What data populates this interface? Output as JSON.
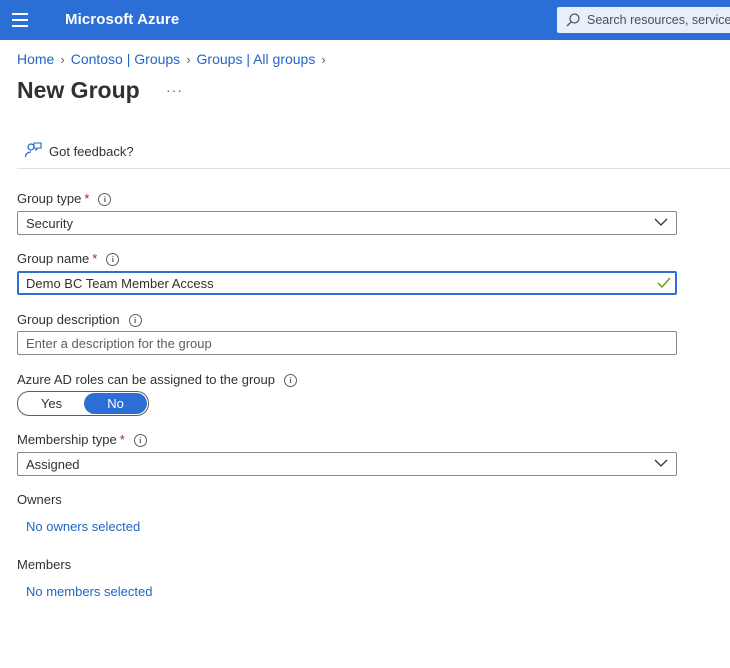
{
  "header": {
    "brand": "Microsoft Azure",
    "search_placeholder": "Search resources, services, and docs"
  },
  "breadcrumb": {
    "items": [
      "Home",
      "Contoso | Groups",
      "Groups | All groups"
    ]
  },
  "page": {
    "title": "New Group",
    "more_label": "···"
  },
  "toolbar": {
    "feedback_label": "Got feedback?"
  },
  "form": {
    "group_type": {
      "label": "Group type",
      "required": "*",
      "value": "Security"
    },
    "group_name": {
      "label": "Group name",
      "required": "*",
      "value": "Demo BC Team Member Access"
    },
    "group_description": {
      "label": "Group description",
      "placeholder": "Enter a description for the group"
    },
    "azure_ad_roles": {
      "label": "Azure AD roles can be assigned to the group",
      "yes_label": "Yes",
      "no_label": "No",
      "selected": "No"
    },
    "membership_type": {
      "label": "Membership type",
      "required": "*",
      "value": "Assigned"
    },
    "owners": {
      "label": "Owners",
      "link": "No owners selected"
    },
    "members": {
      "label": "Members",
      "link": "No members selected"
    }
  },
  "colors": {
    "header_bg": "#2b6fd6",
    "link": "#2266c4",
    "required": "#a4262c",
    "valid": "#57a300"
  }
}
